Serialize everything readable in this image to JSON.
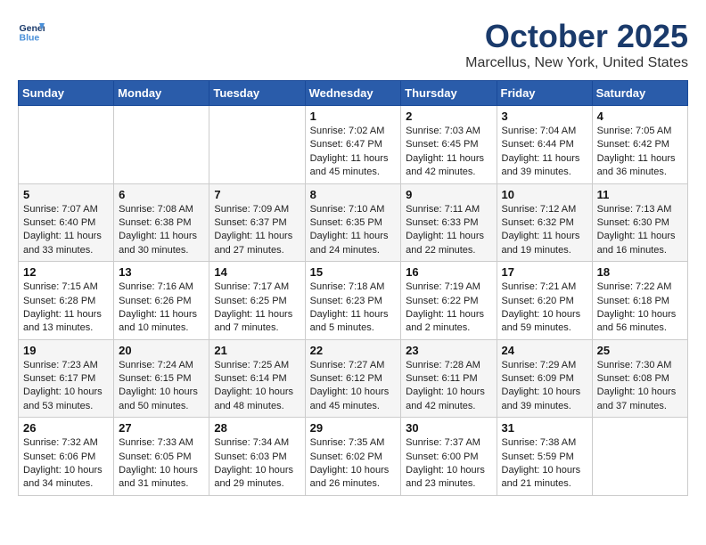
{
  "header": {
    "logo_line1": "General",
    "logo_line2": "Blue",
    "month": "October 2025",
    "location": "Marcellus, New York, United States"
  },
  "days_of_week": [
    "Sunday",
    "Monday",
    "Tuesday",
    "Wednesday",
    "Thursday",
    "Friday",
    "Saturday"
  ],
  "weeks": [
    [
      {
        "day": "",
        "info": ""
      },
      {
        "day": "",
        "info": ""
      },
      {
        "day": "",
        "info": ""
      },
      {
        "day": "1",
        "info": "Sunrise: 7:02 AM\nSunset: 6:47 PM\nDaylight: 11 hours\nand 45 minutes."
      },
      {
        "day": "2",
        "info": "Sunrise: 7:03 AM\nSunset: 6:45 PM\nDaylight: 11 hours\nand 42 minutes."
      },
      {
        "day": "3",
        "info": "Sunrise: 7:04 AM\nSunset: 6:44 PM\nDaylight: 11 hours\nand 39 minutes."
      },
      {
        "day": "4",
        "info": "Sunrise: 7:05 AM\nSunset: 6:42 PM\nDaylight: 11 hours\nand 36 minutes."
      }
    ],
    [
      {
        "day": "5",
        "info": "Sunrise: 7:07 AM\nSunset: 6:40 PM\nDaylight: 11 hours\nand 33 minutes."
      },
      {
        "day": "6",
        "info": "Sunrise: 7:08 AM\nSunset: 6:38 PM\nDaylight: 11 hours\nand 30 minutes."
      },
      {
        "day": "7",
        "info": "Sunrise: 7:09 AM\nSunset: 6:37 PM\nDaylight: 11 hours\nand 27 minutes."
      },
      {
        "day": "8",
        "info": "Sunrise: 7:10 AM\nSunset: 6:35 PM\nDaylight: 11 hours\nand 24 minutes."
      },
      {
        "day": "9",
        "info": "Sunrise: 7:11 AM\nSunset: 6:33 PM\nDaylight: 11 hours\nand 22 minutes."
      },
      {
        "day": "10",
        "info": "Sunrise: 7:12 AM\nSunset: 6:32 PM\nDaylight: 11 hours\nand 19 minutes."
      },
      {
        "day": "11",
        "info": "Sunrise: 7:13 AM\nSunset: 6:30 PM\nDaylight: 11 hours\nand 16 minutes."
      }
    ],
    [
      {
        "day": "12",
        "info": "Sunrise: 7:15 AM\nSunset: 6:28 PM\nDaylight: 11 hours\nand 13 minutes."
      },
      {
        "day": "13",
        "info": "Sunrise: 7:16 AM\nSunset: 6:26 PM\nDaylight: 11 hours\nand 10 minutes."
      },
      {
        "day": "14",
        "info": "Sunrise: 7:17 AM\nSunset: 6:25 PM\nDaylight: 11 hours\nand 7 minutes."
      },
      {
        "day": "15",
        "info": "Sunrise: 7:18 AM\nSunset: 6:23 PM\nDaylight: 11 hours\nand 5 minutes."
      },
      {
        "day": "16",
        "info": "Sunrise: 7:19 AM\nSunset: 6:22 PM\nDaylight: 11 hours\nand 2 minutes."
      },
      {
        "day": "17",
        "info": "Sunrise: 7:21 AM\nSunset: 6:20 PM\nDaylight: 10 hours\nand 59 minutes."
      },
      {
        "day": "18",
        "info": "Sunrise: 7:22 AM\nSunset: 6:18 PM\nDaylight: 10 hours\nand 56 minutes."
      }
    ],
    [
      {
        "day": "19",
        "info": "Sunrise: 7:23 AM\nSunset: 6:17 PM\nDaylight: 10 hours\nand 53 minutes."
      },
      {
        "day": "20",
        "info": "Sunrise: 7:24 AM\nSunset: 6:15 PM\nDaylight: 10 hours\nand 50 minutes."
      },
      {
        "day": "21",
        "info": "Sunrise: 7:25 AM\nSunset: 6:14 PM\nDaylight: 10 hours\nand 48 minutes."
      },
      {
        "day": "22",
        "info": "Sunrise: 7:27 AM\nSunset: 6:12 PM\nDaylight: 10 hours\nand 45 minutes."
      },
      {
        "day": "23",
        "info": "Sunrise: 7:28 AM\nSunset: 6:11 PM\nDaylight: 10 hours\nand 42 minutes."
      },
      {
        "day": "24",
        "info": "Sunrise: 7:29 AM\nSunset: 6:09 PM\nDaylight: 10 hours\nand 39 minutes."
      },
      {
        "day": "25",
        "info": "Sunrise: 7:30 AM\nSunset: 6:08 PM\nDaylight: 10 hours\nand 37 minutes."
      }
    ],
    [
      {
        "day": "26",
        "info": "Sunrise: 7:32 AM\nSunset: 6:06 PM\nDaylight: 10 hours\nand 34 minutes."
      },
      {
        "day": "27",
        "info": "Sunrise: 7:33 AM\nSunset: 6:05 PM\nDaylight: 10 hours\nand 31 minutes."
      },
      {
        "day": "28",
        "info": "Sunrise: 7:34 AM\nSunset: 6:03 PM\nDaylight: 10 hours\nand 29 minutes."
      },
      {
        "day": "29",
        "info": "Sunrise: 7:35 AM\nSunset: 6:02 PM\nDaylight: 10 hours\nand 26 minutes."
      },
      {
        "day": "30",
        "info": "Sunrise: 7:37 AM\nSunset: 6:00 PM\nDaylight: 10 hours\nand 23 minutes."
      },
      {
        "day": "31",
        "info": "Sunrise: 7:38 AM\nSunset: 5:59 PM\nDaylight: 10 hours\nand 21 minutes."
      },
      {
        "day": "",
        "info": ""
      }
    ]
  ]
}
